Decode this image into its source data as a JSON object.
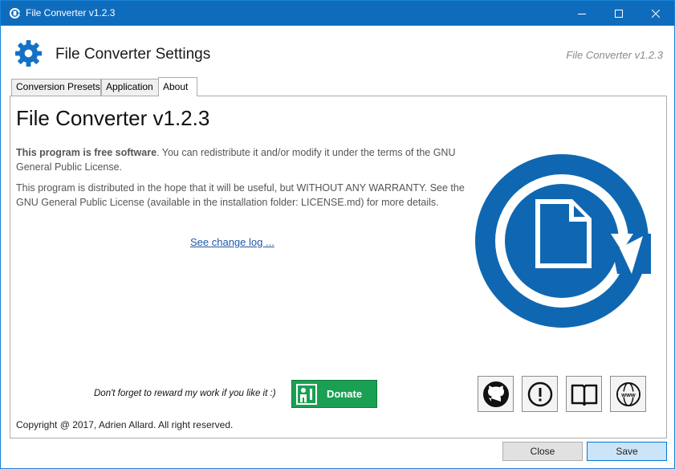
{
  "window": {
    "title": "File Converter v1.2.3",
    "accent": "#0f6cbd"
  },
  "header": {
    "title": "File Converter Settings",
    "version": "File Converter v1.2.3",
    "icon": "gear-icon"
  },
  "tabs": [
    {
      "label": "Conversion Presets",
      "selected": false
    },
    {
      "label": "Application",
      "selected": false
    },
    {
      "label": "About",
      "selected": true
    }
  ],
  "about": {
    "title": "File Converter v1.2.3",
    "para1_bold": "This program is free software",
    "para1_rest": ". You can redistribute it and/or modify it under the terms of the GNU General Public License.",
    "para2": "This program is distributed in the hope that it will be useful, but WITHOUT ANY WARRANTY. See the GNU General Public License (available in the installation folder: LICENSE.md) for more details.",
    "changelog": "See change log ...",
    "reward": "Don't forget to reward my work if you like it :)",
    "donate": "Donate",
    "copyright": "Copyright @ 2017, Adrien Allard. All right reserved.",
    "logo_color": "#0f67b1",
    "link_buttons": [
      "github-icon",
      "issue-icon",
      "documentation-icon",
      "website-icon"
    ],
    "www_text": "www"
  },
  "footer": {
    "close": "Close",
    "save": "Save"
  }
}
